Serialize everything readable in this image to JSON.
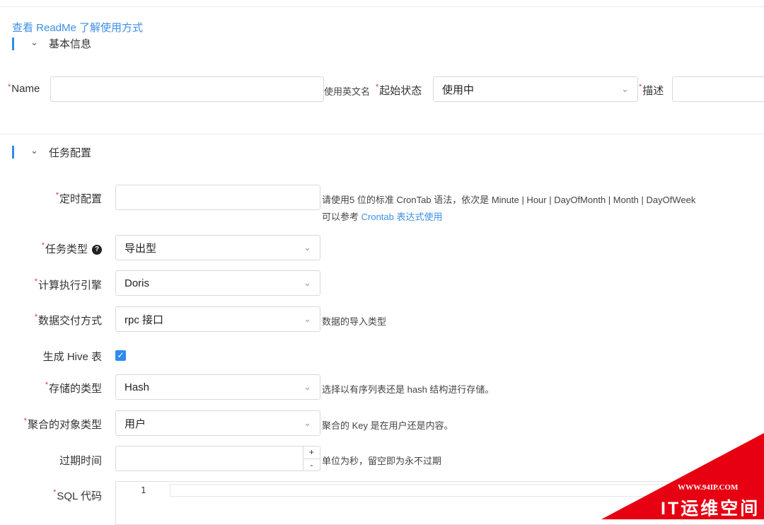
{
  "readme_link": "查看 ReadMe 了解使用方式",
  "basic_section": {
    "title": "基本信息"
  },
  "basic": {
    "name_label": "Name",
    "name_hint": "使用英文名",
    "status_label": "起始状态",
    "status_value": "使用中",
    "desc_label": "描述"
  },
  "task_section": {
    "title": "任务配置"
  },
  "task": {
    "cron_label": "定时配置",
    "cron_hint_line1": "请使用5 位的标准 CronTab 语法，依次是 Minute | Hour | DayOfMonth | Month | DayOfWeek",
    "cron_hint_prefix": "可以参考 ",
    "cron_hint_link": "Crontab 表达式使用",
    "type_label": "任务类型",
    "type_value": "导出型",
    "engine_label": "计算执行引擎",
    "engine_value": "Doris",
    "delivery_label": "数据交付方式",
    "delivery_value": "rpc 接口",
    "delivery_hint": "数据的导入类型",
    "hive_label": "生成 Hive 表",
    "hive_checked": true,
    "storage_label": "存储的类型",
    "storage_value": "Hash",
    "storage_hint": "选择以有序列表还是 hash 结构进行存储。",
    "agg_label": "聚合的对象类型",
    "agg_value": "用户",
    "agg_hint": "聚合的 Key 是在用户还是内容。",
    "expire_label": "过期时间",
    "expire_plus": "+",
    "expire_minus": "-",
    "expire_hint": "单位为秒，留空即为永不过期",
    "sql_label": "SQL 代码",
    "sql_line_number": "1"
  },
  "watermark": {
    "url": "WWW.94IP.COM",
    "text": "IT运维空间"
  },
  "colors": {
    "accent": "#2d8cf0",
    "link": "#3d8fe8",
    "required": "#e4393c",
    "ribbon": "#e60012"
  }
}
